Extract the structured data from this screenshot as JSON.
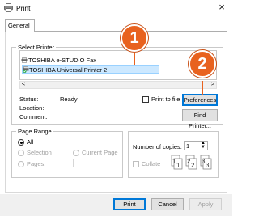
{
  "window": {
    "title": "Print",
    "close_label": "×"
  },
  "tabs": [
    {
      "label": "General"
    }
  ],
  "select_printer": {
    "label": "Select Printer",
    "printers": [
      {
        "name": "TOSHIBA e-STUDIO Fax",
        "selected": false
      },
      {
        "name": "TOSHIBA Universal Printer 2",
        "selected": true
      }
    ]
  },
  "status_info": {
    "status_label": "Status:",
    "status_value": "Ready",
    "location_label": "Location:",
    "comment_label": "Comment:"
  },
  "buttons": {
    "print_to_file": "Print to file",
    "preferences": "Preferences",
    "find_printer": "Find Printer...",
    "print": "Print",
    "cancel": "Cancel",
    "apply": "Apply"
  },
  "page_range": {
    "label": "Page Range",
    "all": "All",
    "selection": "Selection",
    "current_page": "Current Page",
    "pages": "Pages:"
  },
  "copies": {
    "label": "Number of copies:",
    "value": "1",
    "collate": "Collate"
  },
  "callouts": {
    "one": "1",
    "two": "2"
  },
  "colors": {
    "accent": "#0078d7",
    "callout": "#e8621f",
    "selection": "#cce8ff"
  }
}
